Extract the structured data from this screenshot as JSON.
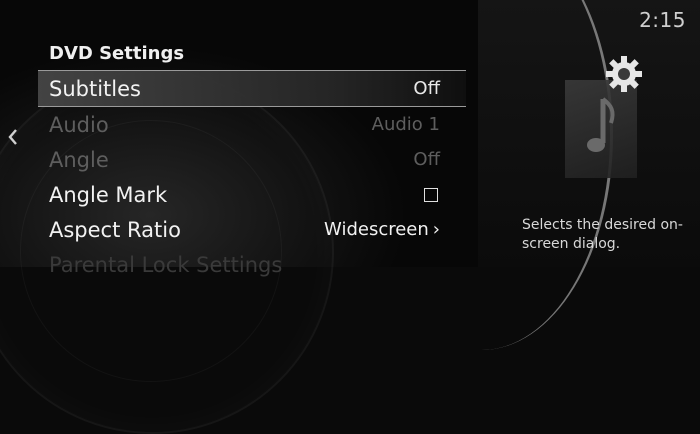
{
  "clock": "2:15",
  "title": "DVD Settings",
  "menu": [
    {
      "label": "Subtitles",
      "value": "Off"
    },
    {
      "label": "Audio",
      "value": "Audio 1"
    },
    {
      "label": "Angle",
      "value": "Off"
    },
    {
      "label": "Angle Mark",
      "value": ""
    },
    {
      "label": "Aspect Ratio",
      "value": "Widescreen"
    },
    {
      "label": "Parental Lock Settings",
      "value": ""
    }
  ],
  "description": "Selects the desired on-screen dialog.",
  "icons": {
    "back": "chevron-left-icon",
    "settings": "gear-icon",
    "media": "music-note-icon",
    "checkbox": "checkbox-icon",
    "submenu": "chevron-right-icon"
  },
  "colors": {
    "background": "#0a0a0a",
    "text": "#f2f2f2",
    "disabled_text": "#5e5e5e",
    "highlight": "#464646"
  }
}
